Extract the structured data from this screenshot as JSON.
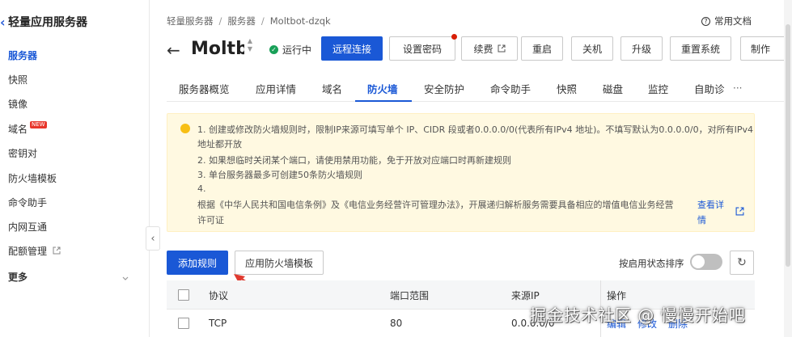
{
  "sidebar": {
    "title": "轻量应用服务器",
    "items": [
      {
        "label": "服务器"
      },
      {
        "label": "快照"
      },
      {
        "label": "镜像"
      },
      {
        "label": "域名",
        "badge": "NEW"
      },
      {
        "label": "密钥对"
      },
      {
        "label": "防火墙模板"
      },
      {
        "label": "命令助手"
      },
      {
        "label": "内网互通"
      },
      {
        "label": "配额管理"
      },
      {
        "label": "更多"
      }
    ]
  },
  "header": {
    "breadcrumb": [
      "轻量服务器",
      "服务器",
      "Moltbot-dzqk"
    ],
    "help_doc": "常用文档",
    "server_name": "Moltbot-dzqk",
    "status": "运行中",
    "buttons": [
      "远程连接",
      "设置密码",
      "续费",
      "重启",
      "关机",
      "升级",
      "重置系统",
      "制作"
    ]
  },
  "tabs": {
    "items": [
      "服务器概览",
      "应用详情",
      "域名",
      "防火墙",
      "安全防护",
      "命令助手",
      "快照",
      "磁盘",
      "监控",
      "自助诊"
    ],
    "active": "防火墙",
    "more": "···"
  },
  "notice": {
    "lines": [
      "1. 创建或修改防火墙规则时，限制IP来源可填写单个 IP、CIDR 段或者0.0.0.0/0(代表所有IPv4 地址)。不填写默认为0.0.0.0/0，对所有IPv4",
      "地址都开放",
      "2. 如果想临时关闭某个端口，请使用禁用功能，免于开放对应端口时再新建规则",
      "3. 单台服务器最多可创建50条防火墙规则",
      "4.",
      "根据《中华人民共和国电信条例》及《电信业务经营许可管理办法》，开展递归解析服务需要具备相应的增值电信业务经营",
      "许可证"
    ],
    "link_line1": "查看详",
    "link_line2": "情"
  },
  "actions": {
    "add_rule": "添加规则",
    "apply_template": "应用防火墙模板",
    "sort_by_status": "按启用状态排序",
    "sort_enabled": false
  },
  "table": {
    "headers": [
      "协议",
      "端口范围",
      "来源IP",
      "操作"
    ],
    "rows": [
      {
        "protocol": "TCP",
        "port": "80",
        "source": "0.0.0.0/0",
        "ops": [
          "编辑",
          "修改",
          "删除"
        ]
      }
    ]
  },
  "watermark": "掘金技术社区 @ 慢慢开始吧",
  "colors": {
    "primary": "#1a58d6",
    "running": "#18a058",
    "notice_bg": "#fff9e1",
    "new_badge": "#e8362b"
  }
}
